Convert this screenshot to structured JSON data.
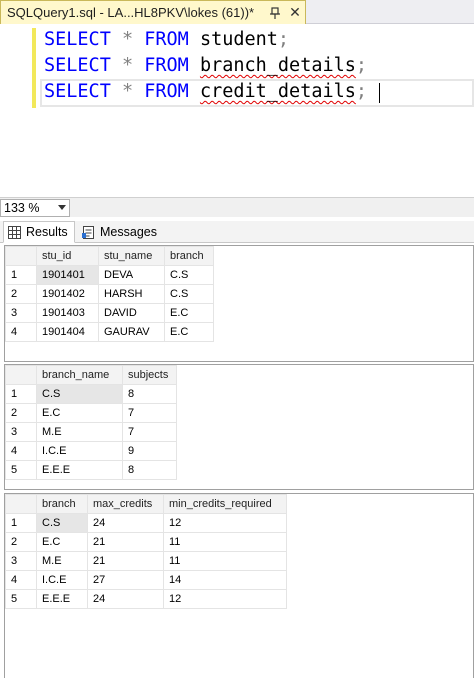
{
  "tab": {
    "title": "SQLQuery1.sql - LA...HL8PKV\\lokes (61))*"
  },
  "editor": {
    "lines": [
      {
        "kw1": "SELECT",
        "star": "*",
        "kw2": "FROM",
        "name": "student",
        "end": ";"
      },
      {
        "kw1": "SELECT",
        "star": "*",
        "kw2": "FROM",
        "name": "branch_details",
        "end": ";"
      },
      {
        "kw1": "SELECT",
        "star": "*",
        "kw2": "FROM",
        "name": "credit_details",
        "end": ";"
      }
    ]
  },
  "zoom": {
    "value": "133 %"
  },
  "results_tabs": {
    "results": "Results",
    "messages": "Messages"
  },
  "grids": [
    {
      "columns": [
        "stu_id",
        "stu_name",
        "branch"
      ],
      "rows": [
        [
          "1",
          "1901401",
          "DEVA",
          "C.S"
        ],
        [
          "2",
          "1901402",
          "HARSH",
          "C.S"
        ],
        [
          "3",
          "1901403",
          "DAVID",
          "E.C"
        ],
        [
          "4",
          "1901404",
          "GAURAV",
          "E.C"
        ]
      ]
    },
    {
      "columns": [
        "branch_name",
        "subjects"
      ],
      "rows": [
        [
          "1",
          "C.S",
          "8"
        ],
        [
          "2",
          "E.C",
          "7"
        ],
        [
          "3",
          "M.E",
          "7"
        ],
        [
          "4",
          "I.C.E",
          "9"
        ],
        [
          "5",
          "E.E.E",
          "8"
        ]
      ]
    },
    {
      "columns": [
        "branch",
        "max_credits",
        "min_credits_required"
      ],
      "rows": [
        [
          "1",
          "C.S",
          "24",
          "12"
        ],
        [
          "2",
          "E.C",
          "21",
          "11"
        ],
        [
          "3",
          "M.E",
          "21",
          "11"
        ],
        [
          "4",
          "I.C.E",
          "27",
          "14"
        ],
        [
          "5",
          "E.E.E",
          "24",
          "12"
        ]
      ]
    }
  ],
  "colors": {
    "keyword": "#0000ff",
    "operator": "#808080",
    "tab_active": "#fff8cc",
    "squiggle": "#e00000"
  }
}
